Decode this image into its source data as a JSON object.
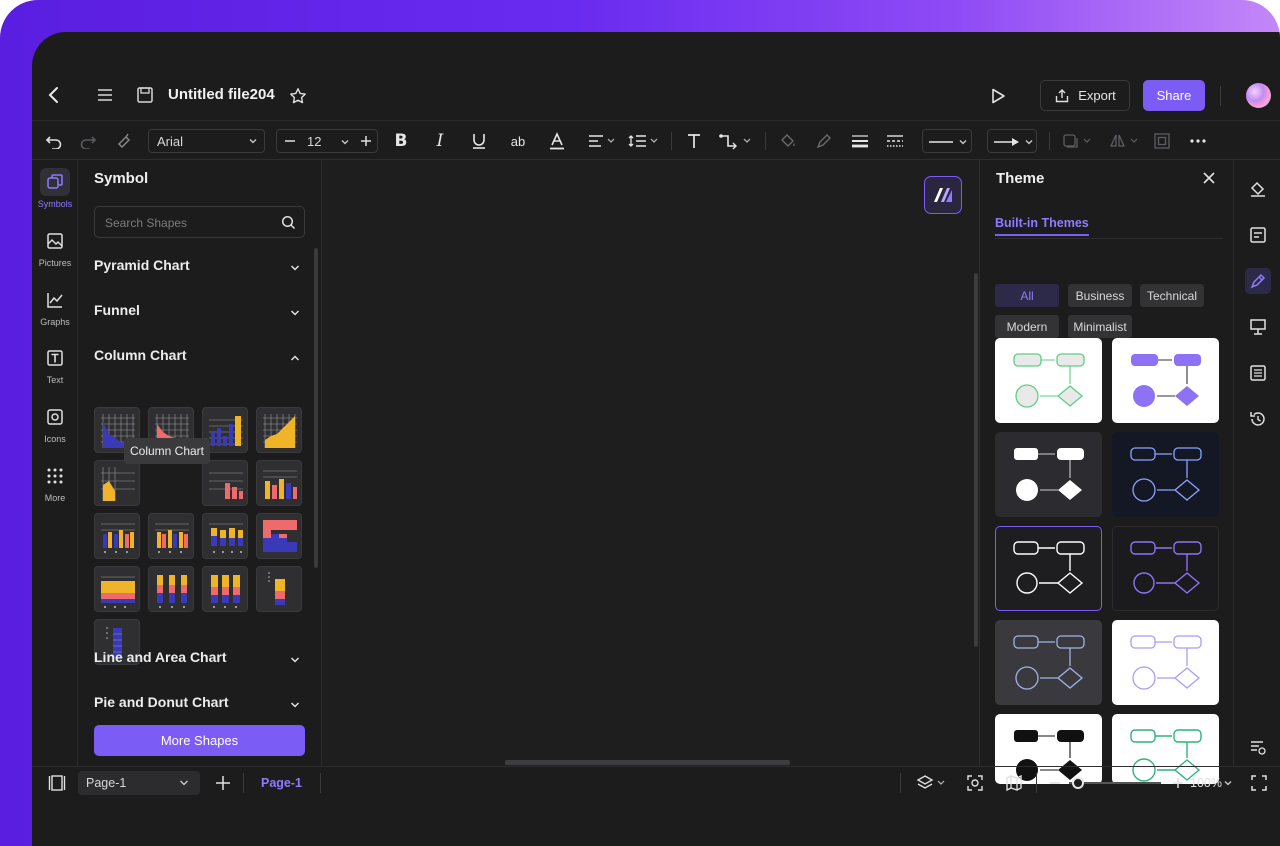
{
  "header": {
    "file_title": "Untitled file204",
    "export_label": "Export",
    "share_label": "Share"
  },
  "toolbar": {
    "font_name": "Arial",
    "font_size": "12"
  },
  "rail": {
    "items": [
      {
        "label": "Symbols",
        "icon": "symbols-icon"
      },
      {
        "label": "Pictures",
        "icon": "pictures-icon"
      },
      {
        "label": "Graphs",
        "icon": "graphs-icon"
      },
      {
        "label": "Text",
        "icon": "text-icon"
      },
      {
        "label": "Icons",
        "icon": "icons-icon"
      },
      {
        "label": "More",
        "icon": "more-grid-icon"
      }
    ]
  },
  "symbol_panel": {
    "title": "Symbol",
    "search_placeholder": "Search Shapes",
    "categories": [
      "Pyramid Chart",
      "Funnel",
      "Column Chart",
      "Line and Area Chart",
      "Pie and Donut Chart"
    ],
    "tooltip": "Column Chart",
    "more_shapes_label": "More Shapes"
  },
  "theme_panel": {
    "title": "Theme",
    "tab_label": "Built-in Themes",
    "filters": [
      "All",
      "Business",
      "Technical",
      "Modern",
      "Minimalist"
    ],
    "active_filter": "All"
  },
  "statusbar": {
    "page_select": "Page-1",
    "page_tab": "Page-1",
    "zoom": "100%"
  },
  "colors": {
    "accent": "#7b5cf5",
    "background": "#1c1c1d"
  }
}
